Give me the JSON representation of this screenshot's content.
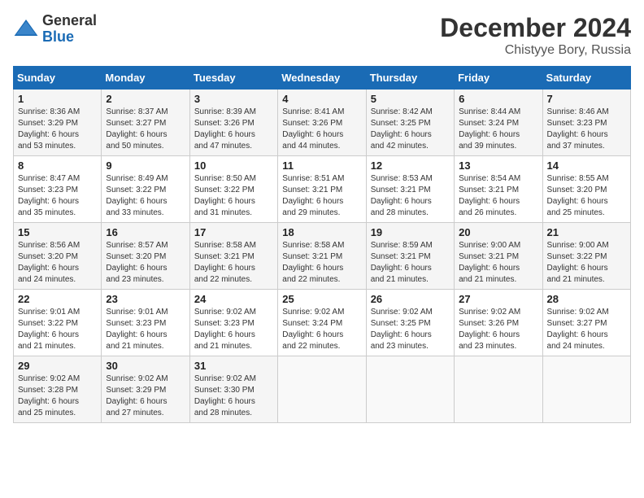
{
  "header": {
    "logo_general": "General",
    "logo_blue": "Blue",
    "month_title": "December 2024",
    "location": "Chistyye Bory, Russia"
  },
  "weekdays": [
    "Sunday",
    "Monday",
    "Tuesday",
    "Wednesday",
    "Thursday",
    "Friday",
    "Saturday"
  ],
  "weeks": [
    [
      {
        "day": "1",
        "sunrise": "8:36 AM",
        "sunset": "3:29 PM",
        "daylight": "6 hours and 53 minutes."
      },
      {
        "day": "2",
        "sunrise": "8:37 AM",
        "sunset": "3:27 PM",
        "daylight": "6 hours and 50 minutes."
      },
      {
        "day": "3",
        "sunrise": "8:39 AM",
        "sunset": "3:26 PM",
        "daylight": "6 hours and 47 minutes."
      },
      {
        "day": "4",
        "sunrise": "8:41 AM",
        "sunset": "3:26 PM",
        "daylight": "6 hours and 44 minutes."
      },
      {
        "day": "5",
        "sunrise": "8:42 AM",
        "sunset": "3:25 PM",
        "daylight": "6 hours and 42 minutes."
      },
      {
        "day": "6",
        "sunrise": "8:44 AM",
        "sunset": "3:24 PM",
        "daylight": "6 hours and 39 minutes."
      },
      {
        "day": "7",
        "sunrise": "8:46 AM",
        "sunset": "3:23 PM",
        "daylight": "6 hours and 37 minutes."
      }
    ],
    [
      {
        "day": "8",
        "sunrise": "8:47 AM",
        "sunset": "3:23 PM",
        "daylight": "6 hours and 35 minutes."
      },
      {
        "day": "9",
        "sunrise": "8:49 AM",
        "sunset": "3:22 PM",
        "daylight": "6 hours and 33 minutes."
      },
      {
        "day": "10",
        "sunrise": "8:50 AM",
        "sunset": "3:22 PM",
        "daylight": "6 hours and 31 minutes."
      },
      {
        "day": "11",
        "sunrise": "8:51 AM",
        "sunset": "3:21 PM",
        "daylight": "6 hours and 29 minutes."
      },
      {
        "day": "12",
        "sunrise": "8:53 AM",
        "sunset": "3:21 PM",
        "daylight": "6 hours and 28 minutes."
      },
      {
        "day": "13",
        "sunrise": "8:54 AM",
        "sunset": "3:21 PM",
        "daylight": "6 hours and 26 minutes."
      },
      {
        "day": "14",
        "sunrise": "8:55 AM",
        "sunset": "3:20 PM",
        "daylight": "6 hours and 25 minutes."
      }
    ],
    [
      {
        "day": "15",
        "sunrise": "8:56 AM",
        "sunset": "3:20 PM",
        "daylight": "6 hours and 24 minutes."
      },
      {
        "day": "16",
        "sunrise": "8:57 AM",
        "sunset": "3:20 PM",
        "daylight": "6 hours and 23 minutes."
      },
      {
        "day": "17",
        "sunrise": "8:58 AM",
        "sunset": "3:21 PM",
        "daylight": "6 hours and 22 minutes."
      },
      {
        "day": "18",
        "sunrise": "8:58 AM",
        "sunset": "3:21 PM",
        "daylight": "6 hours and 22 minutes."
      },
      {
        "day": "19",
        "sunrise": "8:59 AM",
        "sunset": "3:21 PM",
        "daylight": "6 hours and 21 minutes."
      },
      {
        "day": "20",
        "sunrise": "9:00 AM",
        "sunset": "3:21 PM",
        "daylight": "6 hours and 21 minutes."
      },
      {
        "day": "21",
        "sunrise": "9:00 AM",
        "sunset": "3:22 PM",
        "daylight": "6 hours and 21 minutes."
      }
    ],
    [
      {
        "day": "22",
        "sunrise": "9:01 AM",
        "sunset": "3:22 PM",
        "daylight": "6 hours and 21 minutes."
      },
      {
        "day": "23",
        "sunrise": "9:01 AM",
        "sunset": "3:23 PM",
        "daylight": "6 hours and 21 minutes."
      },
      {
        "day": "24",
        "sunrise": "9:02 AM",
        "sunset": "3:23 PM",
        "daylight": "6 hours and 21 minutes."
      },
      {
        "day": "25",
        "sunrise": "9:02 AM",
        "sunset": "3:24 PM",
        "daylight": "6 hours and 22 minutes."
      },
      {
        "day": "26",
        "sunrise": "9:02 AM",
        "sunset": "3:25 PM",
        "daylight": "6 hours and 23 minutes."
      },
      {
        "day": "27",
        "sunrise": "9:02 AM",
        "sunset": "3:26 PM",
        "daylight": "6 hours and 23 minutes."
      },
      {
        "day": "28",
        "sunrise": "9:02 AM",
        "sunset": "3:27 PM",
        "daylight": "6 hours and 24 minutes."
      }
    ],
    [
      {
        "day": "29",
        "sunrise": "9:02 AM",
        "sunset": "3:28 PM",
        "daylight": "6 hours and 25 minutes."
      },
      {
        "day": "30",
        "sunrise": "9:02 AM",
        "sunset": "3:29 PM",
        "daylight": "6 hours and 27 minutes."
      },
      {
        "day": "31",
        "sunrise": "9:02 AM",
        "sunset": "3:30 PM",
        "daylight": "6 hours and 28 minutes."
      },
      null,
      null,
      null,
      null
    ]
  ],
  "labels": {
    "sunrise": "Sunrise:",
    "sunset": "Sunset:",
    "daylight": "Daylight:"
  }
}
